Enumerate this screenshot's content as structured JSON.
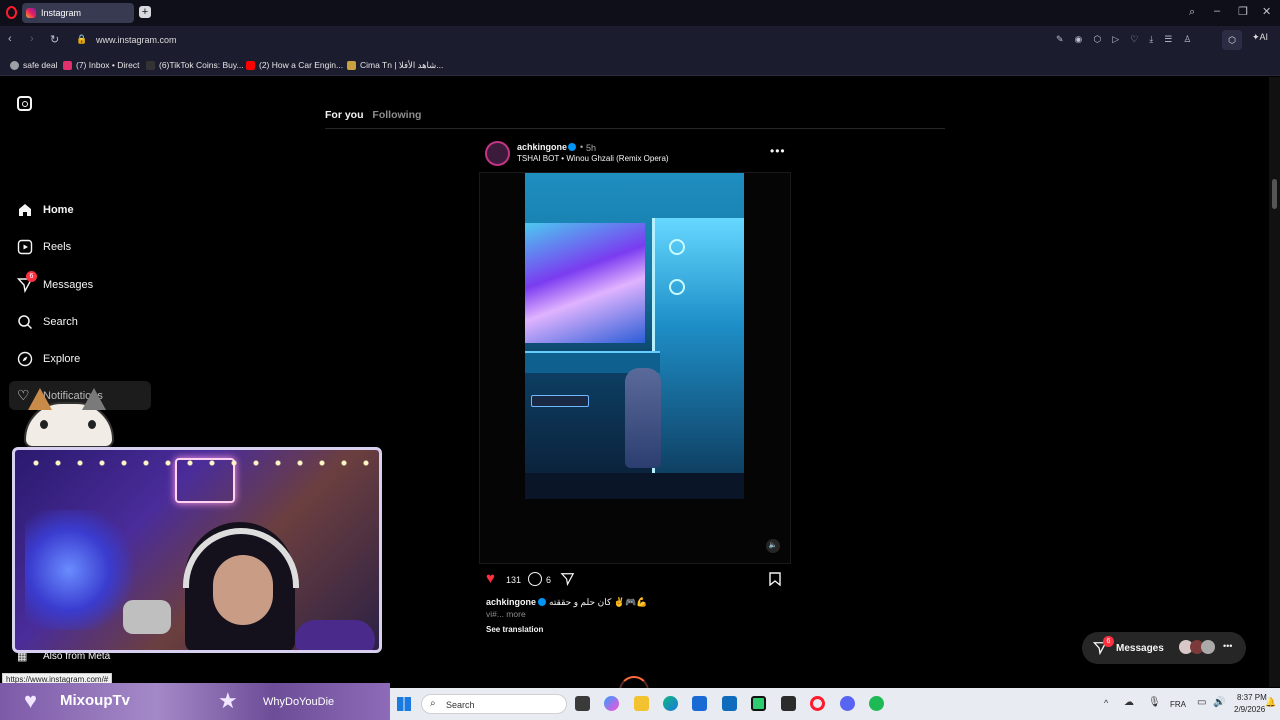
{
  "browser": {
    "tab_title": "Instagram",
    "url": "www.instagram.com",
    "ai_label": "AI",
    "bookmarks": [
      {
        "label": "safe deal",
        "color": "#9aa0a6"
      },
      {
        "label": "(7) Inbox • Direct",
        "color": "#e1306c"
      },
      {
        "label": "(6)TikTok Coins: Buy...",
        "color": "#222222"
      },
      {
        "label": "(2) How a Car Engin...",
        "color": "#ff0000"
      },
      {
        "label": "Cima Tn | شاهد الأفلا...",
        "color": "#c8a040"
      }
    ],
    "status_url": "https://www.instagram.com/#"
  },
  "sidebar": {
    "items": [
      {
        "label": "Home",
        "icon": "home-icon",
        "bold": true
      },
      {
        "label": "Reels",
        "icon": "reels-icon"
      },
      {
        "label": "Messages",
        "icon": "messages-icon",
        "badge": "6"
      },
      {
        "label": "Search",
        "icon": "search-icon"
      },
      {
        "label": "Explore",
        "icon": "explore-icon"
      },
      {
        "label": "Notifications",
        "icon": "heart-icon"
      }
    ],
    "also_from_meta": "Also from Meta"
  },
  "feed": {
    "tabs": [
      "For you",
      "Following"
    ],
    "post": {
      "username": "achkingone",
      "time": "5h",
      "audio": "TSHAI BOT • Winou Ghzali (Remix Opera)",
      "likes": "131",
      "comments": "6",
      "caption_user": "achkingone",
      "caption_text": "كان حلم و حققته ✌️🎮💪",
      "caption_sub": "vi#... more",
      "see_translation": "See translation"
    }
  },
  "messages_pill": {
    "label": "Messages",
    "badge": "6"
  },
  "stream_overlay": {
    "name1": "MixoupTv",
    "name2": "WhyDoYouDie"
  },
  "taskbar": {
    "search_placeholder": "Search",
    "lang": "FRA",
    "time": "8:37 PM",
    "date": "2/9/2026"
  },
  "colors": {
    "accent_blue": "#0095f6",
    "like_red": "#ff3040",
    "page_bg": "#000000"
  }
}
